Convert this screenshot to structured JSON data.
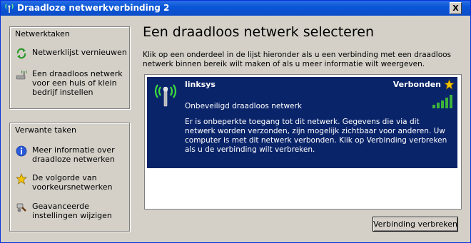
{
  "window": {
    "title": "Draadloze netwerkverbinding 2",
    "close_label": "X"
  },
  "sidebar": {
    "network_tasks": {
      "header": "Netwerktaken",
      "items": [
        {
          "label": "Netwerklijst vernieuwen",
          "icon": "refresh-icon"
        },
        {
          "label": "Een draadloos netwerk voor een huis of klein bedrijf instellen",
          "icon": "wireless-setup-icon"
        }
      ]
    },
    "related_tasks": {
      "header": "Verwante taken",
      "items": [
        {
          "label": "Meer informatie over draadloze netwerken",
          "icon": "info-icon"
        },
        {
          "label": "De volgorde van voorkeursnetwerken",
          "icon": "star-icon"
        },
        {
          "label": "Geavanceerde instellingen wijzigen",
          "icon": "settings-icon"
        }
      ]
    }
  },
  "main": {
    "heading": "Een draadloos netwerk selecteren",
    "description": "Klik op een onderdeel in de lijst hieronder als u een verbinding met een draadloos netwerk binnen bereik wilt maken of als u meer informatie wilt weergeven.",
    "networks": [
      {
        "name": "linksys",
        "status": "Verbonden",
        "security": "Onbeveiligd draadloos netwerk",
        "signal_bars": 5,
        "details": "Er is onbeperkte toegang tot dit netwerk. Gegevens die via dit netwerk worden verzonden, zijn mogelijk zichtbaar voor anderen. Uw computer is met dit netwerk verbonden. Klik op Verbinding verbreken als u de verbinding wilt verbreken."
      }
    ],
    "disconnect_button": "Verbinding verbreken"
  },
  "colors": {
    "titlebar": "#0a56d8",
    "selected_item": "#0a246a",
    "signal_green": "#3cb33c",
    "star": "#f5c400"
  }
}
